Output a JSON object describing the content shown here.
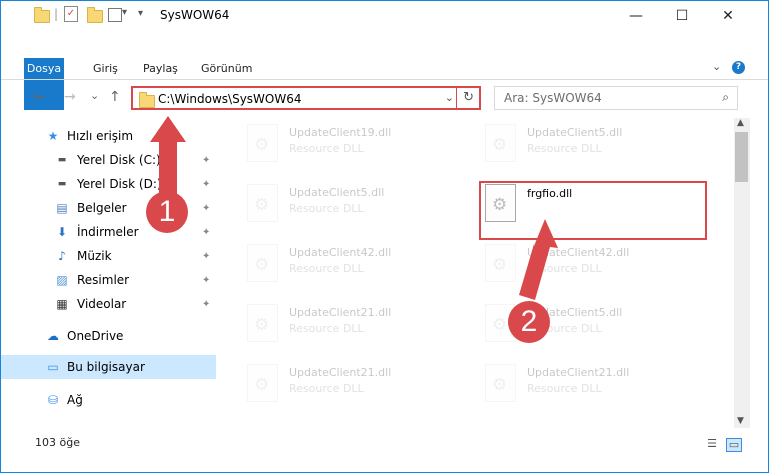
{
  "window": {
    "title": "SysWOW64",
    "minimize": "—",
    "maximize": "☐",
    "close": "✕",
    "quick_access_separator": "|",
    "quick_access_down": "▾"
  },
  "ribbon": {
    "tabs": [
      "Dosya",
      "Giriş",
      "Paylaş",
      "Görünüm"
    ],
    "expand_icon": "⌄",
    "help": "?"
  },
  "address": {
    "path": "C:\\Windows\\SysWOW64",
    "search_placeholder": "Ara: SysWOW64",
    "back": "←",
    "forward": "→",
    "recent": "⌄",
    "up": "↑",
    "dropdown": "⌄",
    "refresh": "↻",
    "search_glyph": "⌕"
  },
  "nav": {
    "items": [
      {
        "label": "Hızlı erişim",
        "icon": "star-icon",
        "glyph": "★",
        "color": "#3a8ee6"
      },
      {
        "label": "Yerel Disk (C:)",
        "icon": "drive-icon",
        "glyph": "▬",
        "color": "#555555",
        "pinned": true
      },
      {
        "label": "Yerel Disk (D:)",
        "icon": "drive-icon",
        "glyph": "▬",
        "color": "#555555",
        "pinned": true
      },
      {
        "label": "Belgeler",
        "icon": "documents-icon",
        "glyph": "▤",
        "color": "#4d7fb8",
        "pinned": true
      },
      {
        "label": "İndirmeler",
        "icon": "download-icon",
        "glyph": "⬇",
        "color": "#2a73c5",
        "pinned": true
      },
      {
        "label": "Müzik",
        "icon": "music-icon",
        "glyph": "♪",
        "color": "#2a73c5",
        "pinned": true
      },
      {
        "label": "Resimler",
        "icon": "pictures-icon",
        "glyph": "▨",
        "color": "#4d8fd0",
        "pinned": true
      },
      {
        "label": "Videolar",
        "icon": "videos-icon",
        "glyph": "▦",
        "color": "#333333",
        "pinned": true
      },
      {
        "label": "OneDrive",
        "icon": "cloud-icon",
        "glyph": "☁",
        "color": "#1a6fc9"
      },
      {
        "label": "Bu bilgisayar",
        "icon": "computer-icon",
        "glyph": "▭",
        "color": "#3a8ee6"
      },
      {
        "label": "Ağ",
        "icon": "network-icon",
        "glyph": "⛁",
        "color": "#3a8ee6"
      }
    ],
    "pin_glyph": "📌"
  },
  "files": [
    {
      "name": "UpdateClient19.dll",
      "type": "Resource DLL"
    },
    {
      "name": "UpdateClient5.dll",
      "type": "Resource DLL"
    },
    {
      "name": "UpdateClient5.dll",
      "type": "Resource DLL"
    },
    {
      "name": "frgfio.dll",
      "type": ""
    },
    {
      "name": "UpdateClient42.dll",
      "type": "Resource DLL"
    },
    {
      "name": "UpdateClient42.dll",
      "type": "Resource DLL"
    },
    {
      "name": "UpdateClient21.dll",
      "type": "Resource DLL"
    },
    {
      "name": "UpdateClient5.dll",
      "type": "Resource DLL"
    },
    {
      "name": "UpdateClient21.dll",
      "type": "Resource DLL"
    },
    {
      "name": "UpdateClient21.dll",
      "type": "Resource DLL"
    }
  ],
  "status": {
    "count": "103 öğe"
  },
  "callouts": [
    "1",
    "2"
  ],
  "colors": {
    "accent": "#1979ca",
    "highlight": "#d9484a",
    "selected": "#cce8ff"
  }
}
